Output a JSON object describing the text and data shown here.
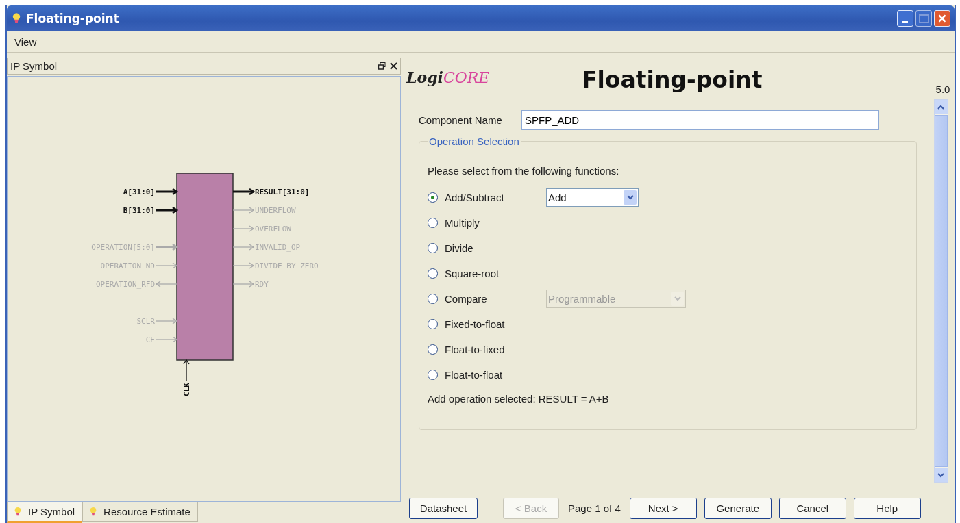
{
  "window": {
    "title": "Floating-point"
  },
  "menu": [
    "View"
  ],
  "left_panel": {
    "title": "IP Symbol",
    "symbol": {
      "left_pin_groups": [
        [
          {
            "label": "A[31:0]",
            "active": true,
            "bus": true,
            "kind": "input"
          },
          {
            "label": "B[31:0]",
            "active": true,
            "bus": true,
            "kind": "input"
          }
        ],
        [
          {
            "label": "OPERATION[5:0]",
            "active": false,
            "bus": true,
            "kind": "input"
          },
          {
            "label": "OPERATION_ND",
            "active": false,
            "bus": false,
            "kind": "input"
          },
          {
            "label": "OPERATION_RFD",
            "active": false,
            "bus": false,
            "kind": "output"
          }
        ],
        [
          {
            "label": "SCLR",
            "active": false,
            "bus": false,
            "kind": "input"
          },
          {
            "label": "CE",
            "active": false,
            "bus": false,
            "kind": "input"
          }
        ]
      ],
      "right_pins": [
        {
          "label": "RESULT[31:0]",
          "active": true,
          "bus": true,
          "kind": "output"
        },
        {
          "label": "UNDERFLOW",
          "active": false,
          "bus": false,
          "kind": "output"
        },
        {
          "label": "OVERFLOW",
          "active": false,
          "bus": false,
          "kind": "output"
        },
        {
          "label": "INVALID_OP",
          "active": false,
          "bus": false,
          "kind": "output"
        },
        {
          "label": "DIVIDE_BY_ZERO",
          "active": false,
          "bus": false,
          "kind": "output"
        },
        {
          "label": "RDY",
          "active": false,
          "bus": false,
          "kind": "output"
        }
      ],
      "bottom_pins": [
        {
          "label": "CLK",
          "active": true,
          "bus": false,
          "kind": "input"
        }
      ]
    },
    "tabs": [
      {
        "label": "IP Symbol",
        "selected": true
      },
      {
        "label": "Resource Estimate",
        "selected": false
      }
    ]
  },
  "header": {
    "logo": {
      "dark": "Logi",
      "colored": "CORE"
    },
    "title": "Floating-point",
    "version": "5.0"
  },
  "component_name": {
    "label": "Component Name",
    "value": "SPFP_ADD"
  },
  "operation_selection": {
    "title": "Operation Selection",
    "prompt": "Please select from the following functions:",
    "options": [
      {
        "label": "Add/Subtract",
        "selected": true,
        "dropdown": {
          "value": "Add",
          "disabled": false
        }
      },
      {
        "label": "Multiply",
        "selected": false
      },
      {
        "label": "Divide",
        "selected": false
      },
      {
        "label": "Square-root",
        "selected": false
      },
      {
        "label": "Compare",
        "selected": false,
        "dropdown": {
          "value": "Programmable",
          "disabled": true
        }
      },
      {
        "label": "Fixed-to-float",
        "selected": false
      },
      {
        "label": "Float-to-fixed",
        "selected": false
      },
      {
        "label": "Float-to-float",
        "selected": false
      }
    ],
    "summary": "Add operation selected: RESULT = A+B"
  },
  "buttons": [
    {
      "kind": "button",
      "label": "Datasheet",
      "disabled": false
    },
    {
      "kind": "button",
      "label": "< Back",
      "disabled": true
    },
    {
      "kind": "text",
      "label": "Page 1 of 4"
    },
    {
      "kind": "button",
      "label": "Next >",
      "disabled": false
    },
    {
      "kind": "button",
      "label": "Generate",
      "disabled": false
    },
    {
      "kind": "button",
      "label": "Cancel",
      "disabled": false
    },
    {
      "kind": "button",
      "label": "Help",
      "disabled": false
    }
  ]
}
